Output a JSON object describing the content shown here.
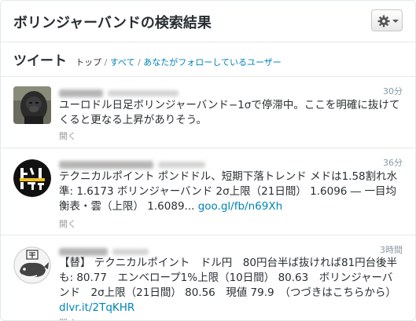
{
  "header": {
    "title": "ボリンジャーバンドの検索結果",
    "gear_icon": "gear-icon"
  },
  "filter": {
    "heading": "ツイート",
    "top": "トップ",
    "sep1": " / ",
    "all": "すべて",
    "sep2": " / ",
    "following": "あなたがフォローしているユーザー"
  },
  "tweets": [
    {
      "avatar": "gorilla-photo-avatar",
      "time": "30分",
      "text": "ユーロドル日足ボリンジャーバンド−1σで停滞中。ここを明確に抜けてくると更なる上昇がありそう。",
      "link": "",
      "expand": "開く"
    },
    {
      "avatar": "toreplus-logo-avatar",
      "time": "36分",
      "text": "テクニカルポイント ポンドドル、短期下落トレンド メドは1.58割れ水準: 1.6173 ボリンジャーバンド 2σ上限（21日間） 1.6096 ― 一目均衡表・雲（上限） 1.6089...",
      "link": "goo.gl/fb/n69Xh",
      "expand": "開く"
    },
    {
      "avatar": "whale-logo-avatar",
      "time": "3時間",
      "text": "【替】 テクニカルポイント　ドル円　80円台半ば抜ければ81円台後半も: 80.77　エンベロープ1%上限（10日間） 80.63　ボリンジャーバンド　2σ上限（21日間） 80.56　現値 79.9　（つづきはこちらから）",
      "link": "dlvr.it/2TqKHR",
      "expand": "開く"
    }
  ]
}
